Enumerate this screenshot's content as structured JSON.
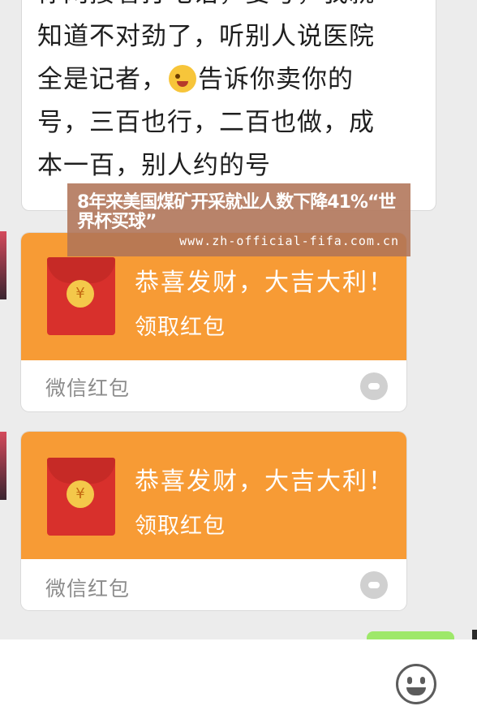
{
  "message": {
    "lines": [
      "你网接着打电话，要号，我就",
      "知道不对劲了，听别人说医院",
      "全是记者，",
      "号，三百也行，二百也做，成",
      "本一百，别人约的号"
    ],
    "line3_after_emoji": "告诉你卖你的",
    "emoji_icon": "winking-tongue-emoji-icon"
  },
  "red_packets": [
    {
      "title": "恭喜发财，大吉大利！",
      "action": "领取红包",
      "footer": "微信红包",
      "coin_symbol": "¥"
    },
    {
      "title": "恭喜发财，大吉大利！",
      "action": "领取红包",
      "footer": "微信红包",
      "coin_symbol": "¥"
    }
  ],
  "overlay": {
    "headline": "8年来美国煤矿开采就业人数下降41%“世界杯买球”",
    "url": "www.zh-official-fifa.com.cn"
  },
  "colors": {
    "red_packet_orange": "#f79b35",
    "envelope_red": "#d8302c",
    "outgoing_bubble_green": "#9ee86a",
    "overlay_brown": "#b07458"
  },
  "input_bar": {
    "emoji_button_icon": "smiley-face-icon"
  }
}
